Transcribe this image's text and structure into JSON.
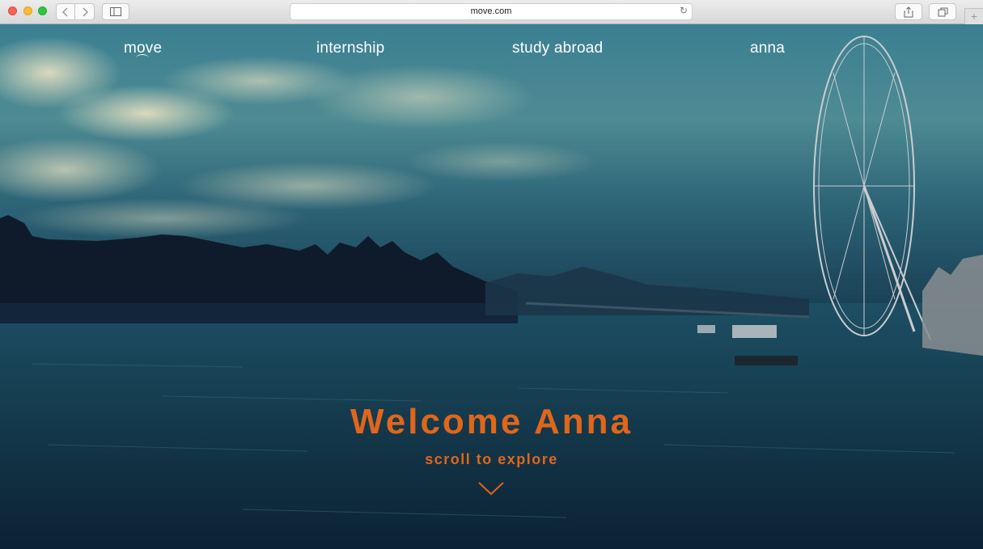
{
  "browser": {
    "url": "move.com",
    "icons": [
      "back-arrow-icon",
      "forward-arrow-icon",
      "sidebar-icon",
      "reload-icon",
      "share-icon",
      "tabs-icon",
      "new-tab-icon"
    ]
  },
  "nav": {
    "logo": "move",
    "items": [
      "internship",
      "study abroad",
      "anna"
    ]
  },
  "hero": {
    "title": "Welcome Anna",
    "subtitle": "scroll to explore",
    "scroll_icon": "chevron-down-icon"
  },
  "colors": {
    "accent": "#e0661b",
    "nav_text": "#ffffff"
  }
}
